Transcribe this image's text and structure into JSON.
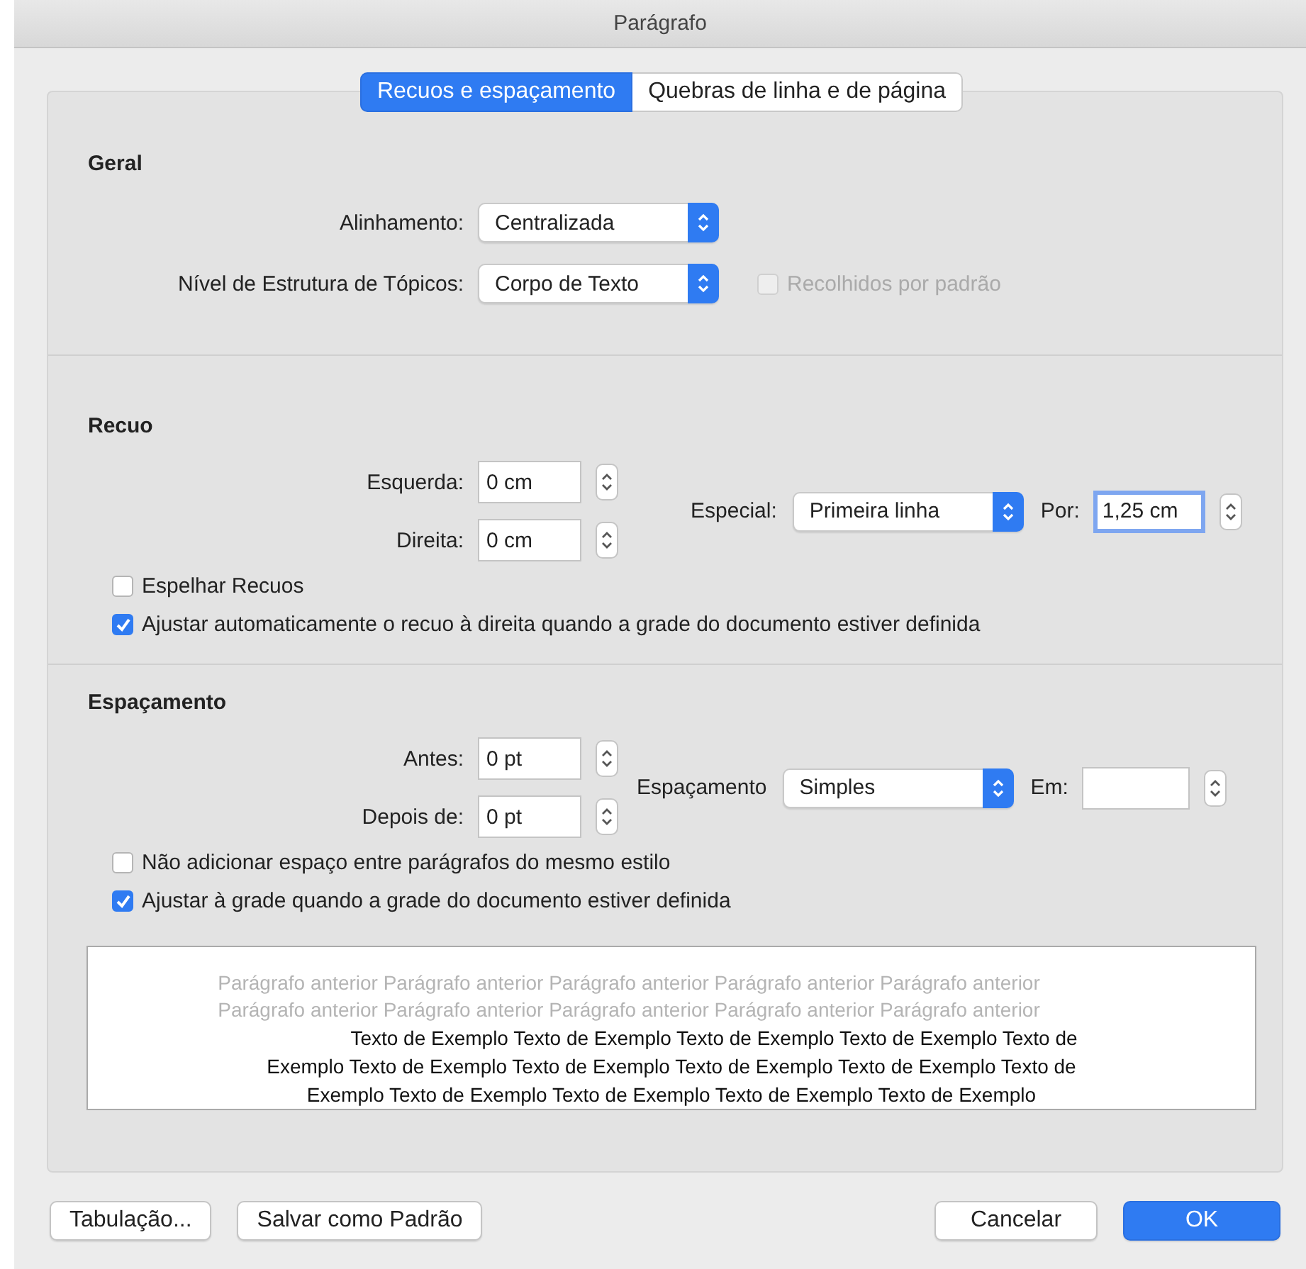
{
  "window": {
    "title": "Parágrafo"
  },
  "tabs": [
    {
      "label": "Recuos e espaçamento",
      "selected": true
    },
    {
      "label": "Quebras de linha e de página",
      "selected": false
    }
  ],
  "general": {
    "heading": "Geral",
    "alignment": {
      "label": "Alinhamento:",
      "value": "Centralizada"
    },
    "outline_level": {
      "label": "Nível de Estrutura de Tópicos:",
      "value": "Corpo de Texto"
    },
    "collapsed": {
      "label": "Recolhidos por padrão",
      "checked": false,
      "disabled": true
    }
  },
  "indent": {
    "heading": "Recuo",
    "left": {
      "label": "Esquerda:",
      "value": "0 cm"
    },
    "right": {
      "label": "Direita:",
      "value": "0 cm"
    },
    "special": {
      "label": "Especial:",
      "value": "Primeira linha"
    },
    "by": {
      "label": "Por:",
      "value": "1,25 cm",
      "focused": true
    },
    "checks": [
      {
        "label": "Espelhar Recuos",
        "checked": false
      },
      {
        "label": "Ajustar automaticamente o recuo à direita quando a grade do documento estiver definida",
        "checked": true
      }
    ]
  },
  "spacing": {
    "heading": "Espaçamento",
    "before": {
      "label": "Antes:",
      "value": "0 pt"
    },
    "after": {
      "label": "Depois de:",
      "value": "0 pt"
    },
    "line": {
      "label": "Espaçamento",
      "value": "Simples"
    },
    "at": {
      "label": "Em:",
      "focused": false
    },
    "checks": [
      {
        "label": "Não adicionar espaço entre parágrafos do mesmo estilo",
        "checked": false
      },
      {
        "label": "Ajustar à grade quando a grade do documento estiver definida",
        "checked": true
      }
    ]
  },
  "preview": {
    "previous_lines": [
      "Parágrafo anterior Parágrafo anterior Parágrafo anterior Parágrafo anterior Parágrafo anterior",
      "Parágrafo anterior Parágrafo anterior Parágrafo anterior Parágrafo anterior Parágrafo anterior"
    ],
    "sample_lines": [
      "Texto de Exemplo Texto de Exemplo Texto de Exemplo Texto de Exemplo Texto de",
      "Exemplo Texto de Exemplo Texto de Exemplo Texto de Exemplo Texto de Exemplo Texto de",
      "Exemplo Texto de Exemplo Texto de Exemplo Texto de Exemplo Texto de Exemplo"
    ]
  },
  "buttons": [
    {
      "label": "Tabulação...",
      "kind": "normal"
    },
    {
      "label": "Salvar como Padrão",
      "kind": "normal"
    },
    {
      "label": "Cancelar",
      "kind": "normal"
    },
    {
      "label": "OK",
      "kind": "default"
    }
  ]
}
